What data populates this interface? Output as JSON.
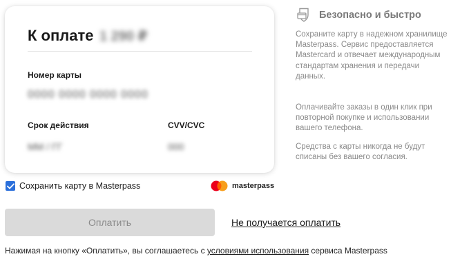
{
  "payment": {
    "title": "К оплате",
    "amount": "1 290 ₽",
    "card_number_label": "Номер карты",
    "card_number_value": "0000 0000 0000 0000",
    "expiry_label": "Срок действия",
    "expiry_value": "ММ / ГГ",
    "cvv_label": "CVV/CVC",
    "cvv_value": "000"
  },
  "save_card": {
    "label": "Сохранить карту в Masterpass",
    "checked": true
  },
  "brand": {
    "name": "masterpass",
    "colors": {
      "red": "#eb001b",
      "orange": "#f79e1b",
      "overlap": "#ff5f00"
    }
  },
  "actions": {
    "pay_label": "Оплатить",
    "cant_pay_label": "Не получается оплатить"
  },
  "footer": {
    "prefix": "Нажимая на кнопку «Оплатить», вы соглашаетесь с ",
    "link": "условиями использования",
    "suffix": " сервиса Masterpass"
  },
  "sidebar": {
    "title": "Безопасно и быстро",
    "icon": "shield-card-icon",
    "paragraphs": [
      "Сохраните карту в надежном хранилище Masterpass. Сервис предоставляется Mastercard и отвечает международным стандартам хранения и передачи данных.",
      "Оплачивайте заказы в один клик при повторной покупке и использовании вашего телефона.",
      "Средства с карты никогда не будут списаны без вашего согласия."
    ]
  },
  "colors": {
    "checkbox": "#2a6fdb",
    "button_disabled_bg": "#dadada",
    "button_disabled_text": "#8a8a8a",
    "sidebar_text": "#8a8a8a"
  }
}
